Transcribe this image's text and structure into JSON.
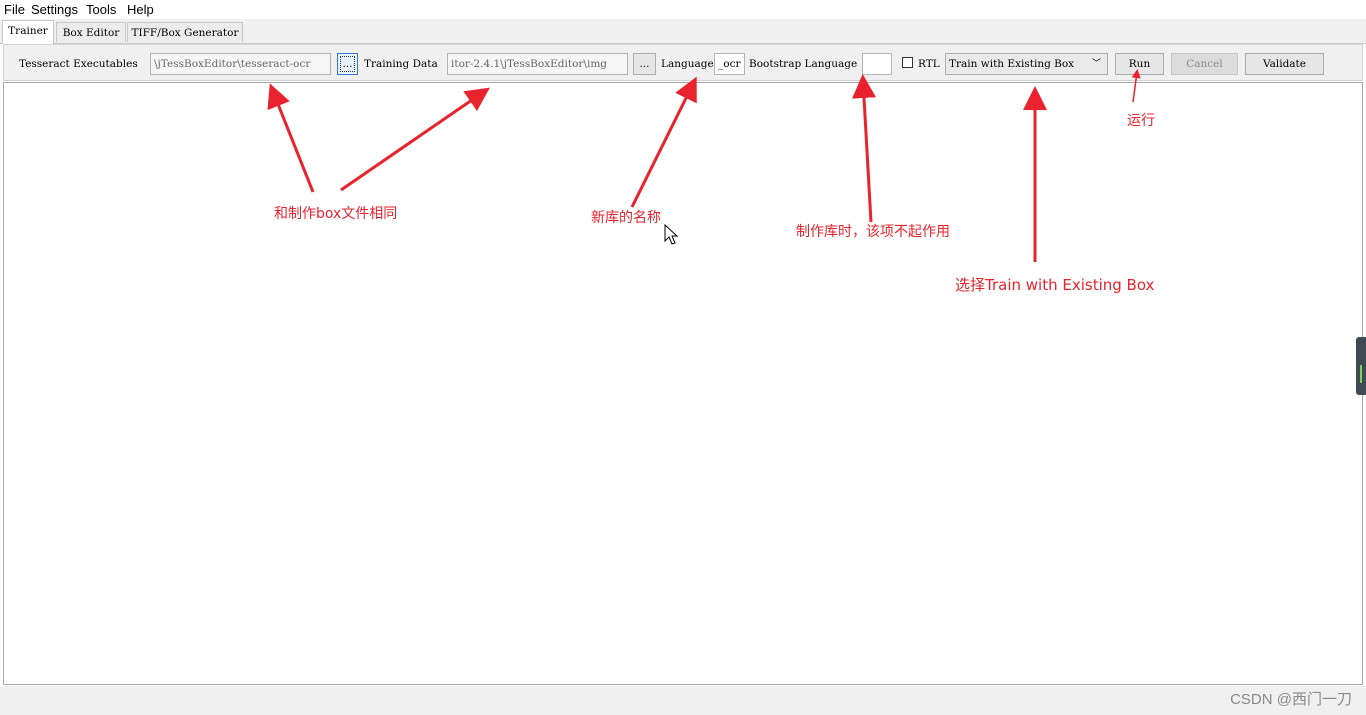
{
  "menu": [
    "File",
    "Settings",
    "Tools",
    "Help"
  ],
  "tabs": [
    "Trainer",
    "Box Editor",
    "TIFF/Box Generator"
  ],
  "toolbar": {
    "tesseract_label": "Tesseract Executables",
    "tesseract_value": "\\jTessBoxEditor\\tesseract-ocr",
    "browse_label": "...",
    "training_label": "Training Data",
    "training_value": "itor-2.4.1\\jTessBoxEditor\\img",
    "language_label": "Language",
    "language_value": "_ocr",
    "bootstrap_label": "Bootstrap Language",
    "bootstrap_value": "",
    "rtl_label": "RTL",
    "mode_value": "Train with Existing Box",
    "run_label": "Run",
    "cancel_label": "Cancel",
    "validate_label": "Validate"
  },
  "annotations": {
    "same_as_box": "和制作box文件相同",
    "new_lib_name": "新库的名称",
    "no_effect": "制作库时，该项不起作用",
    "select_mode": "选择Train with Existing Box",
    "run": "运行"
  },
  "watermark": "CSDN @西门一刀",
  "colors": {
    "annotation": "#e8232d",
    "toolbar_bg": "#f0f0f0",
    "focus_border": "#3a78c8"
  }
}
